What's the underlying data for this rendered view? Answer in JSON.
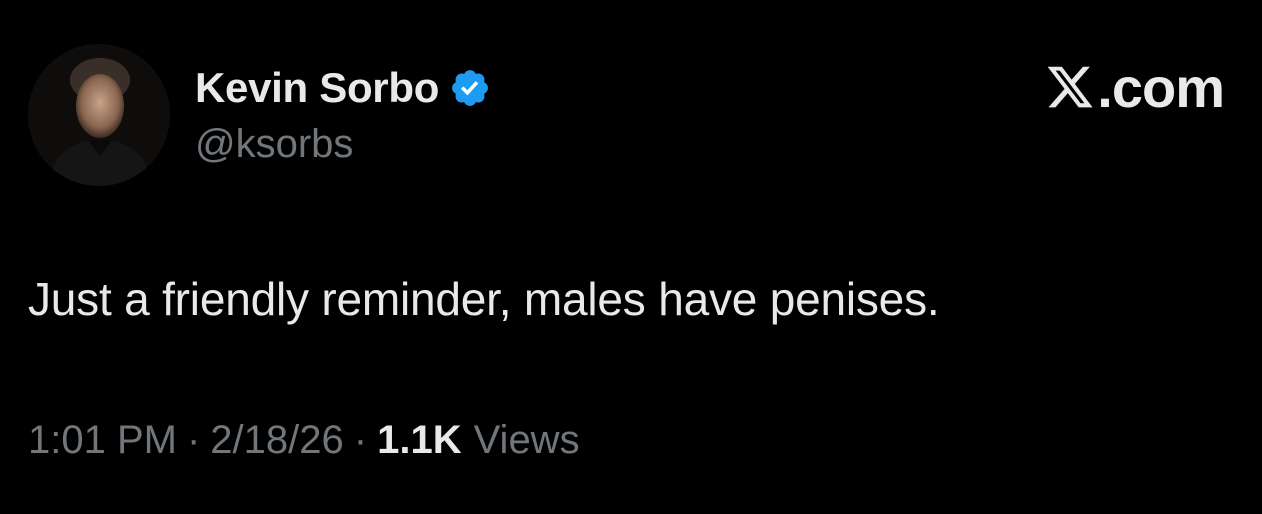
{
  "author": {
    "display_name": "Kevin Sorbo",
    "handle": "@ksorbs",
    "verified": true,
    "verified_badge_icon": "verified-badge-icon",
    "verified_color": "#1d9bf0",
    "avatar_icon": "profile-photo"
  },
  "brand": {
    "logo_icon": "x-logo-icon",
    "text": ".com"
  },
  "tweet": {
    "text": "Just a friendly reminder, males have penises."
  },
  "meta": {
    "time": "1:01 PM",
    "separator": "·",
    "date": "2/18/26",
    "views_count": "1.1K",
    "views_label": "Views"
  },
  "colors": {
    "background": "#000000",
    "primary_text": "#e7e9ea",
    "secondary_text": "#71767b"
  }
}
